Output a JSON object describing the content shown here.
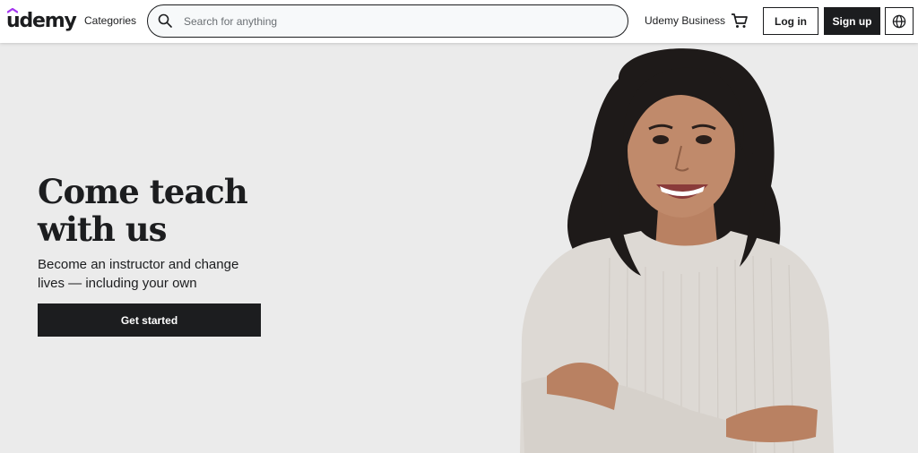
{
  "header": {
    "logo_text": "udemy",
    "categories_label": "Categories",
    "search": {
      "placeholder": "Search for anything",
      "value": ""
    },
    "business_link": "Udemy Business",
    "login_label": "Log in",
    "signup_label": "Sign up",
    "icons": {
      "search": "search-icon",
      "cart": "cart-icon",
      "language": "globe-icon"
    }
  },
  "hero": {
    "title_line1": "Come teach",
    "title_line2": "with us",
    "subtitle": "Become an instructor and change lives — including your own",
    "cta_label": "Get started"
  },
  "colors": {
    "text_dark": "#1c1d1f",
    "hero_background": "#ebebeb",
    "brand_purple": "#a435f0",
    "button_dark": "#1c1d1f"
  }
}
